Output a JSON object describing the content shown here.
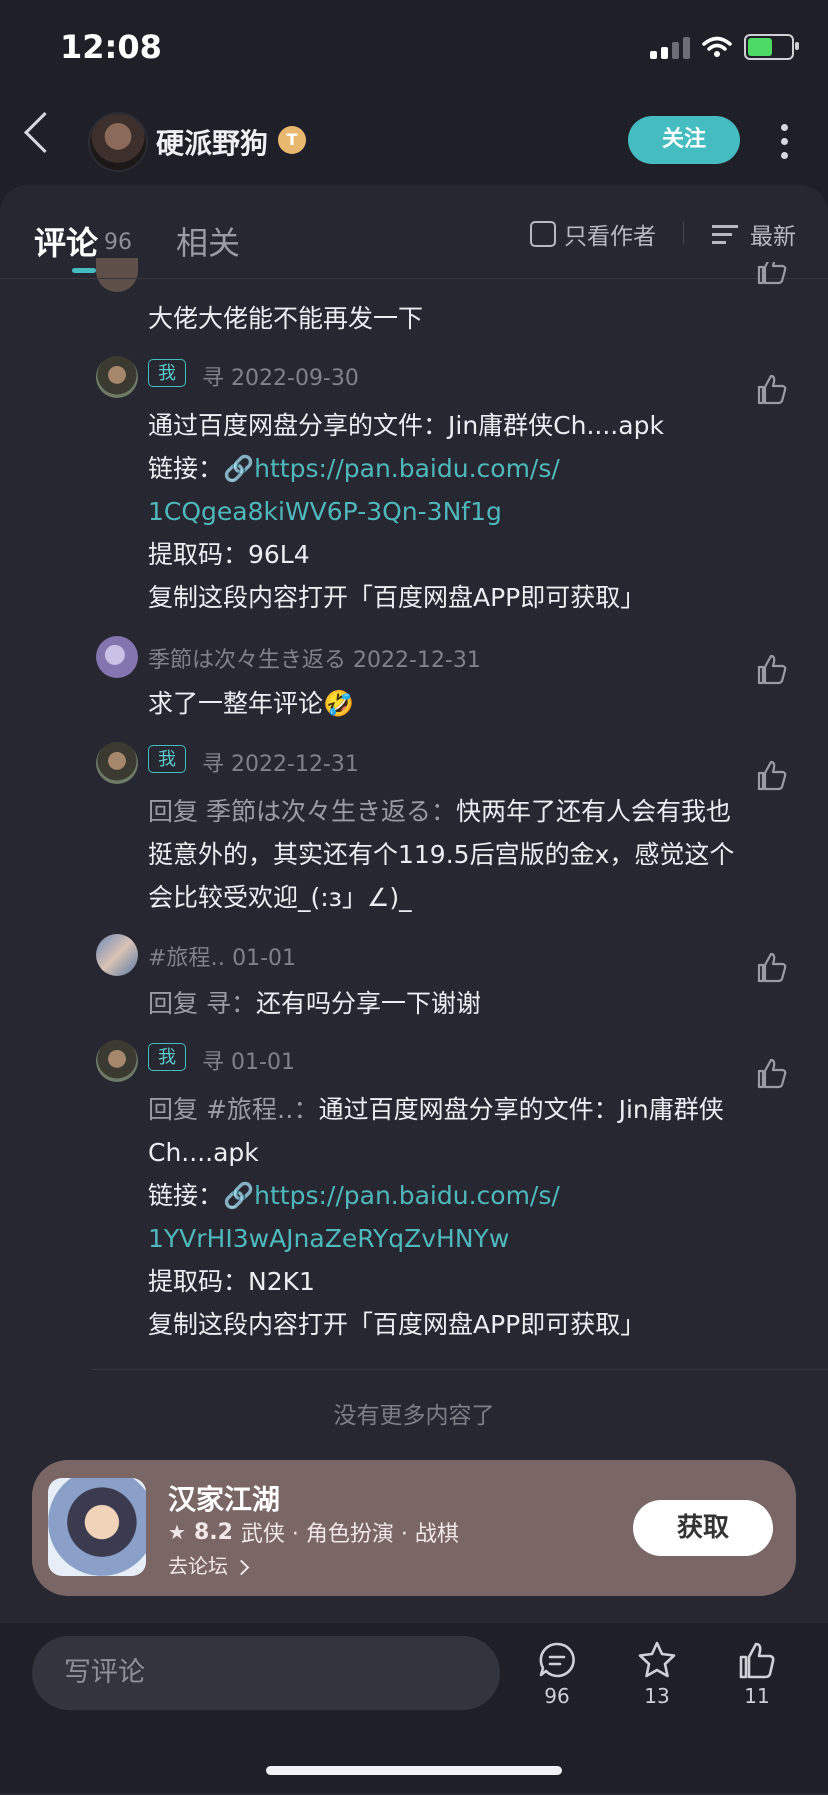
{
  "status_bar": {
    "time": "12:08"
  },
  "header": {
    "user_name": "硬派野狗",
    "user_badge": "T",
    "follow_label": "关注"
  },
  "tabs": {
    "comments_label": "评论",
    "comments_count": "96",
    "related_label": "相关",
    "author_only_label": "只看作者",
    "sort_label": "最新"
  },
  "comments": [
    {
      "body": "大佬大佬能不能再发一下"
    },
    {
      "me_badge": "我",
      "user": "寻",
      "date": "2022-09-30",
      "line1": "通过百度网盘分享的文件：Jin庸群侠Ch....apk",
      "link_prefix": "链接：🔗",
      "link1": "https://pan.baidu.com/s/",
      "link2": "1CQgea8kiWV6P-3Qn-3Nf1g",
      "code": "提取码：96L4",
      "footer": "复制这段内容打开「百度网盘APP即可获取」"
    },
    {
      "user": "季節は次々生き返る",
      "date": "2022-12-31",
      "body": "求了一整年评论🤣"
    },
    {
      "me_badge": "我",
      "user": "寻",
      "date": "2022-12-31",
      "reply_prefix": "回复 季節は次々生き返る：",
      "body": "快两年了还有人会有我也挺意外的，其实还有个119.5后宫版的金x，感觉这个会比较受欢迎_(:з」∠)_"
    },
    {
      "user": "#旅程‥",
      "date": "01-01",
      "reply_prefix": "回复 寻：",
      "body": "还有吗分享一下谢谢"
    },
    {
      "me_badge": "我",
      "user": "寻",
      "date": "01-01",
      "reply_prefix": "回复 #旅程‥：",
      "body": "通过百度网盘分享的文件：Jin庸群侠Ch....apk",
      "link_prefix": "链接：🔗",
      "link1": "https://pan.baidu.com/s/",
      "link2": "1YVrHI3wAJnaZeRYqZvHNYw",
      "code": "提取码：N2K1",
      "footer": "复制这段内容打开「百度网盘APP即可获取」"
    }
  ],
  "no_more": "没有更多内容了",
  "game_card": {
    "name": "汉家江湖",
    "rating": "8.2",
    "tags": "武侠 · 角色扮演 · 战棋",
    "forum_link": "去论坛",
    "get_label": "获取"
  },
  "bottom_bar": {
    "write_placeholder": "写评论",
    "comment_count": "96",
    "favorite_count": "13",
    "like_count": "11"
  },
  "icons": [
    "back-icon",
    "more-icon",
    "checkbox-icon",
    "sort-icon",
    "thumb-up-icon",
    "link-icon",
    "star-icon",
    "chevron-right-icon",
    "comment-icon",
    "favorite-star-icon",
    "like-icon"
  ],
  "colors": {
    "accent": "#44bcc0",
    "background": "#1f2027",
    "sheet": "#262730",
    "game_card": "#7a6665"
  }
}
